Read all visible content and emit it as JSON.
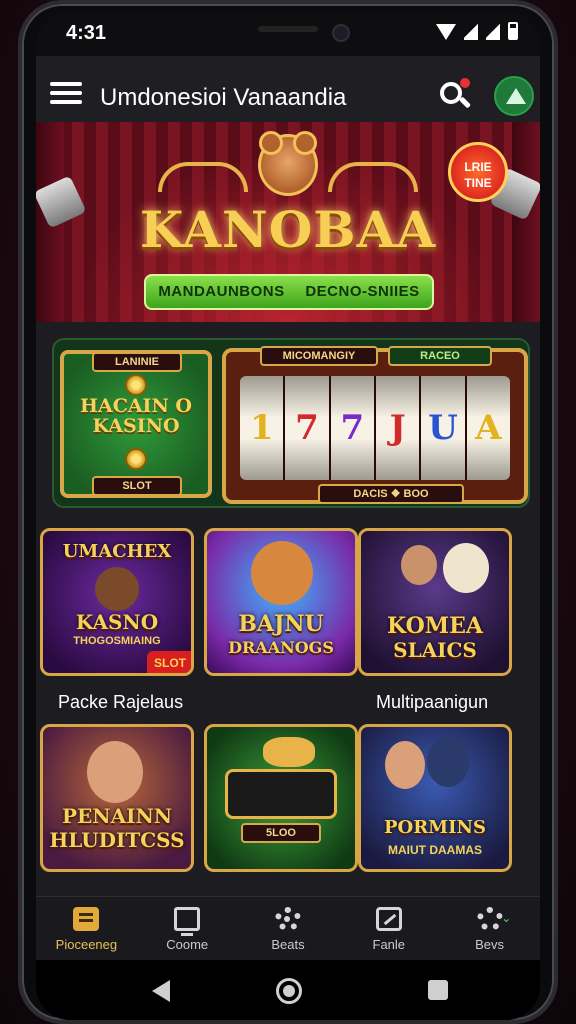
{
  "status_bar": {
    "time": "4:31"
  },
  "app_bar": {
    "title": "Umdonesioi Vanaandia"
  },
  "hero": {
    "wordmark": "KANOBAA",
    "ribbon_left": "MANDAUNBONS",
    "ribbon_right": "DECNO-SNIIES",
    "badge": "LRIE TINE"
  },
  "slot_panel": {
    "kasino_card": {
      "top_plaque": "LANINIE",
      "title": "HACAIN O KASINO",
      "bottom_plaque": "SLOT"
    },
    "machine": {
      "top_plaque": "MICOMANGIY",
      "top_plaque_2": "RACEO",
      "reels": [
        "1",
        "7",
        "7",
        "J",
        "U",
        "A"
      ],
      "bottom_plaque": "DACIS  ❖  BOO"
    }
  },
  "tiles_row_1": [
    {
      "title": "UMACHEX",
      "subtitle": "KASNO",
      "small": "THOGOSMIAING",
      "tag": "SLOT"
    },
    {
      "title": "BAJNU",
      "subtitle": "DRAANOGS"
    },
    {
      "title": "KOMEA",
      "subtitle": "SLAICS"
    }
  ],
  "section_labels": {
    "left": "Packe Rajelaus",
    "right": "Multipaanigun"
  },
  "tiles_row_2": [
    {
      "title": "PENAINN",
      "subtitle": "HLUDITCSS"
    },
    {
      "title": "",
      "subtitle": "5LOO"
    },
    {
      "title": "PORMINS",
      "subtitle": "MAIUT DAAMAS"
    }
  ],
  "bottom_nav": [
    {
      "label": "Pioceeneg",
      "icon": "home-card-icon"
    },
    {
      "label": "Coome",
      "icon": "monitor-icon"
    },
    {
      "label": "Beats",
      "icon": "gear-icon"
    },
    {
      "label": "Fanle",
      "icon": "pencil-icon"
    },
    {
      "label": "Bevs",
      "icon": "settings-icon"
    }
  ],
  "colors": {
    "accent_gold": "#d9a646",
    "nav_active": "#e8c15a",
    "badge_red": "#d91f1f",
    "ribbon_green": "#3ea41c"
  }
}
